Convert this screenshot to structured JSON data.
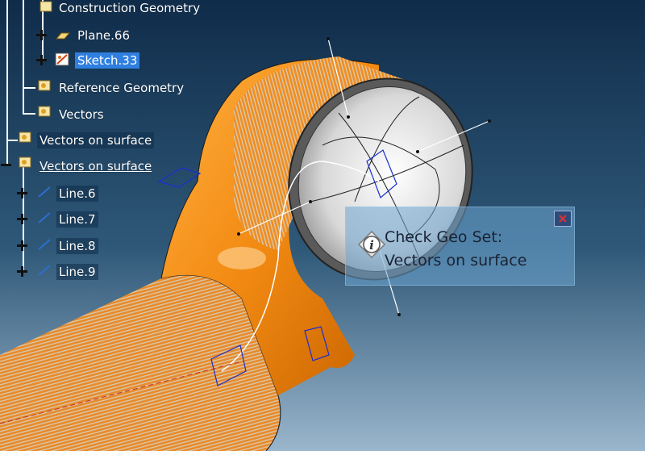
{
  "tree": {
    "items": [
      {
        "label": "Construction Geometry",
        "icon": "geometrical-set-icon"
      },
      {
        "label": "Plane.66",
        "icon": "plane-icon"
      },
      {
        "label": "Sketch.33",
        "icon": "sketch-icon",
        "selected": true
      },
      {
        "label": "Reference Geometry",
        "icon": "geometrical-set-icon"
      },
      {
        "label": "Vectors",
        "icon": "geometrical-set-icon"
      },
      {
        "label": "Vectors on surface",
        "icon": "geometrical-set-icon"
      },
      {
        "label": "Vectors on surface",
        "icon": "geometrical-set-icon"
      },
      {
        "label": "Line.6",
        "icon": "line-icon"
      },
      {
        "label": "Line.7",
        "icon": "line-icon"
      },
      {
        "label": "Line.8",
        "icon": "line-icon"
      },
      {
        "label": "Line.9",
        "icon": "line-icon"
      }
    ]
  },
  "tooltip": {
    "line1": "Check Geo Set:",
    "line2": "Vectors on surface",
    "info_icon": "info-icon",
    "close_icon": "close-icon"
  },
  "colors": {
    "selection": "#2f7fe0",
    "surface_orange": "#f08a10",
    "background_top": "#12304f",
    "background_bottom": "#8fb0c8"
  }
}
